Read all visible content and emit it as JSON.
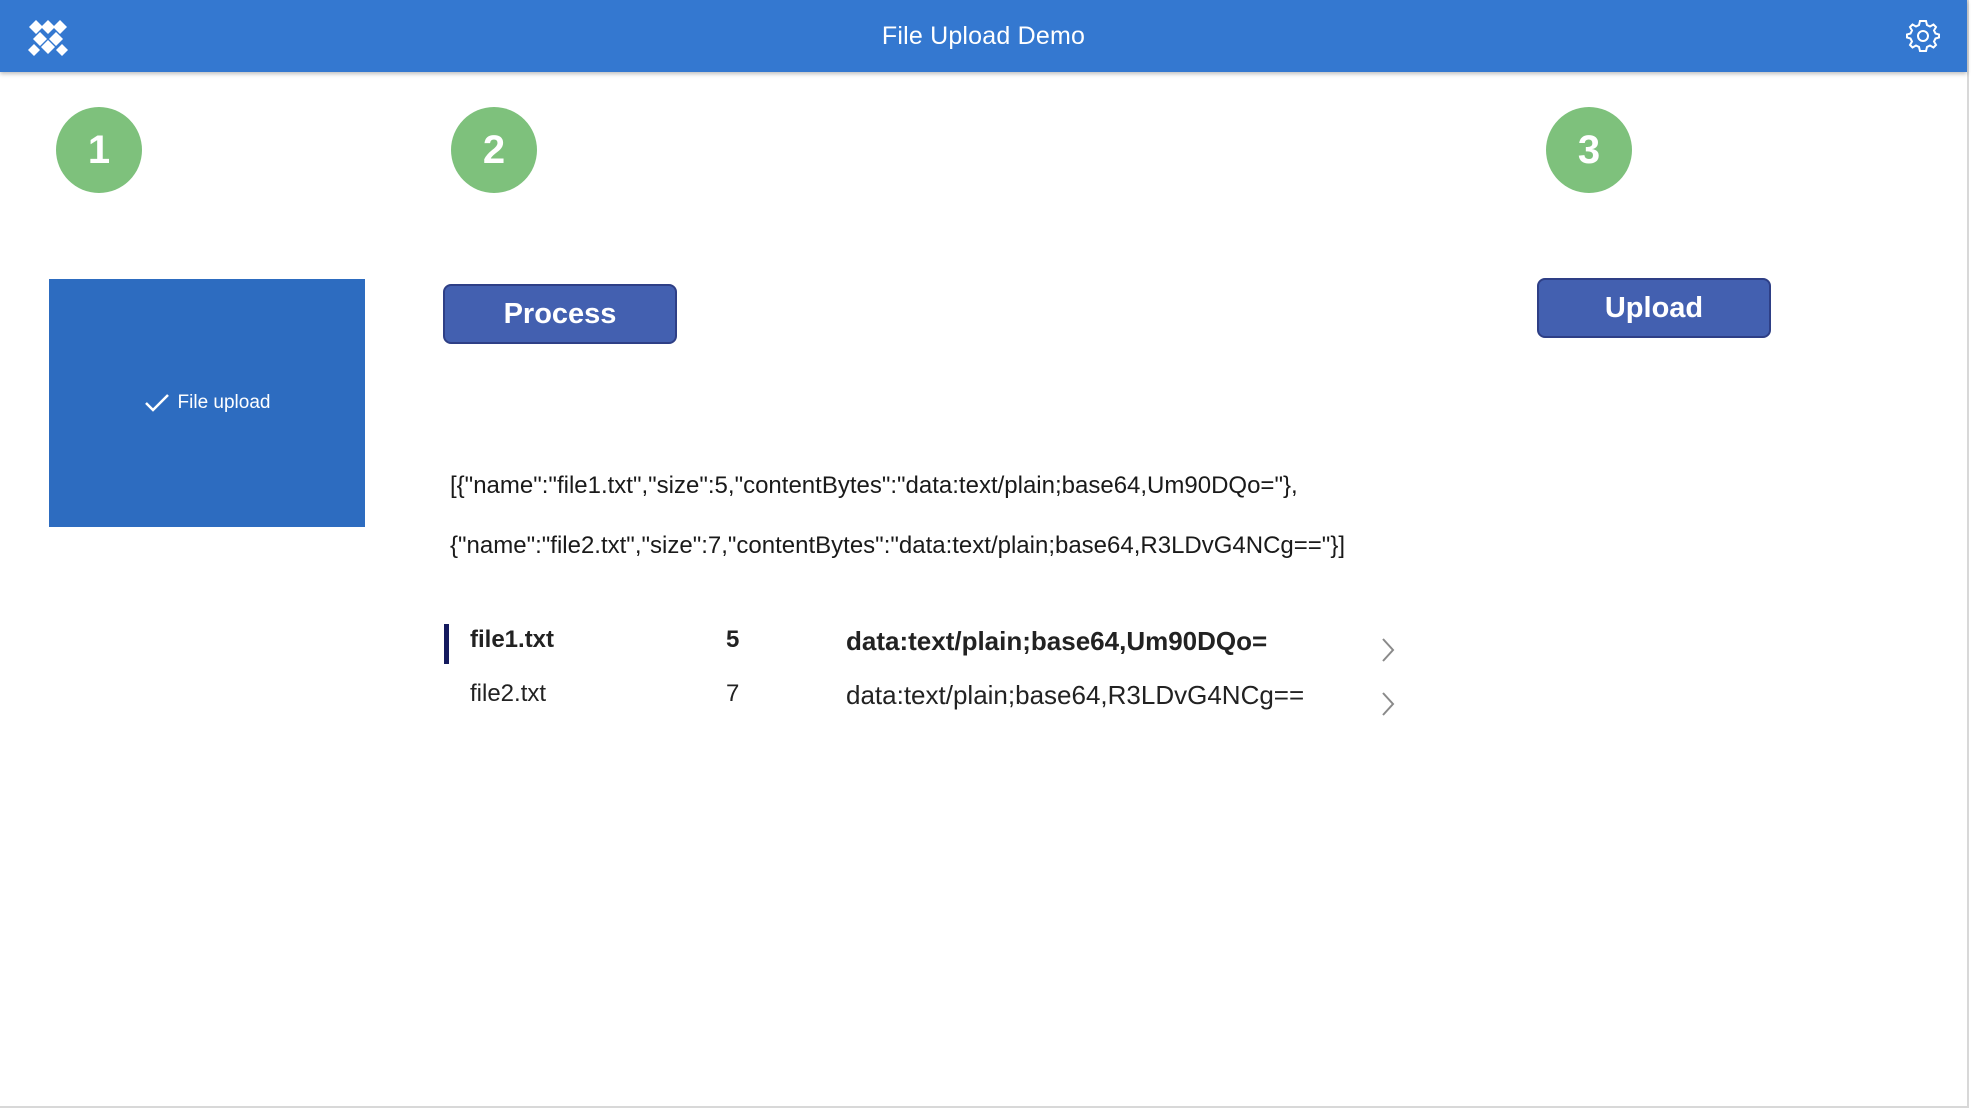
{
  "header": {
    "title": "File Upload Demo",
    "logo_icon": "app-logo-icon",
    "settings_icon": "gear-icon",
    "background_color": "#3478d0"
  },
  "steps": [
    "1",
    "2",
    "3"
  ],
  "upload_control": {
    "label": "File upload",
    "icon": "checkmark-icon"
  },
  "buttons": {
    "process_label": "Process",
    "upload_label": "Upload"
  },
  "json_output": {
    "line1": "[{\"name\":\"file1.txt\",\"size\":5,\"contentBytes\":\"data:text/plain;base64,Um90DQo=\"},",
    "line2": "{\"name\":\"file2.txt\",\"size\":7,\"contentBytes\":\"data:text/plain;base64,R3LDvG4NCg==\"}]"
  },
  "gallery": {
    "rows": [
      {
        "name": "file1.txt",
        "size": "5",
        "content": "data:text/plain;base64,Um90DQo=",
        "selected": true
      },
      {
        "name": "file2.txt",
        "size": "7",
        "content": "data:text/plain;base64,R3LDvG4NCg==",
        "selected": false
      }
    ]
  },
  "colors": {
    "accent": "#3478d0",
    "step_circle": "#7ec17c",
    "button": "#4360b0",
    "upload_box": "#2d6cc0"
  }
}
